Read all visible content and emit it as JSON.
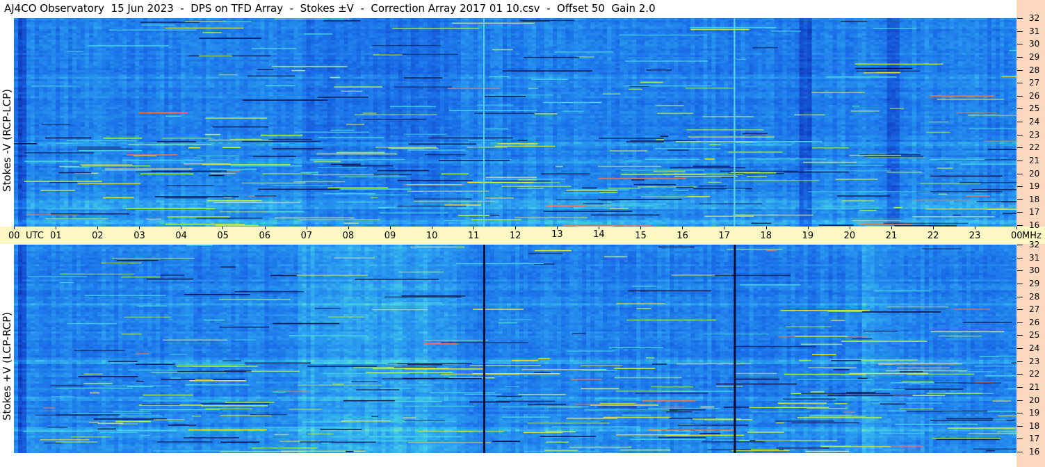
{
  "header": {
    "title": "AJ4CO Observatory  15 Jun 2023  -  DPS on TFD Array  -  Stokes ±V  -  Correction Array 2017 01 10.csv  -  Offset 50  Gain 2.0"
  },
  "colors": {
    "background": "#ffffff",
    "time_band": "#fdf7c3",
    "freq_strip": "#fcd9be",
    "spectrogram_base": "#1a6ee8"
  },
  "chart_data": [
    {
      "type": "heatmap",
      "title": "",
      "ylabel": "Stokes -V (RCP-LCP)",
      "xlabel": "UTC",
      "y_unit": "MHz",
      "x_range": [
        0,
        24
      ],
      "y_range": [
        16,
        32
      ],
      "x_ticks": [
        "00",
        "01",
        "02",
        "03",
        "04",
        "05",
        "06",
        "07",
        "08",
        "09",
        "10",
        "11",
        "12",
        "13",
        "14",
        "15",
        "16",
        "17",
        "18",
        "19",
        "20",
        "21",
        "22",
        "23",
        "00"
      ],
      "y_ticks": [
        "32",
        "31",
        "30",
        "29",
        "28",
        "27",
        "26",
        "25",
        "24",
        "23",
        "22",
        "21",
        "20",
        "19",
        "18",
        "17",
        "16"
      ],
      "vertical_lines_utc": [
        11.25,
        17.25
      ],
      "vertical_line_color": "#58d6f0",
      "dark_columns_utc": [
        0.2,
        18.95,
        21.05
      ],
      "bright_rows_mhz": [
        27.4,
        22.3,
        21.0,
        17.8,
        17.5,
        16.3
      ],
      "colormap": [
        "#0a1e78",
        "#1246c8",
        "#1a6ee8",
        "#2a9cf0",
        "#46d2e6",
        "#b4f050",
        "#f0e628"
      ]
    },
    {
      "type": "heatmap",
      "title": "",
      "ylabel": "Stokes +V (LCP-RCP)",
      "xlabel": "UTC",
      "y_unit": "MHz",
      "x_range": [
        0,
        24
      ],
      "y_range": [
        16,
        32
      ],
      "x_ticks": [
        "00",
        "01",
        "02",
        "03",
        "04",
        "05",
        "06",
        "07",
        "08",
        "09",
        "10",
        "11",
        "12",
        "13",
        "14",
        "15",
        "16",
        "17",
        "18",
        "19",
        "20",
        "21",
        "22",
        "23",
        "00"
      ],
      "y_ticks": [
        "32",
        "31",
        "30",
        "29",
        "28",
        "27",
        "26",
        "25",
        "24",
        "23",
        "22",
        "21",
        "20",
        "19",
        "18",
        "17",
        "16"
      ],
      "vertical_lines_utc": [
        11.25,
        17.25
      ],
      "vertical_line_color": "#04103a",
      "dark_columns_utc": [
        0.2
      ],
      "bright_rows_mhz": [
        27.4,
        23.0,
        20.2,
        17.8
      ],
      "colormap": [
        "#0a1e78",
        "#1246c8",
        "#1a6ee8",
        "#2a9cf0",
        "#46d2e6",
        "#b4f050",
        "#f0e628"
      ]
    }
  ],
  "axis": {
    "utc_label": "UTC",
    "mhz_label": "MHz"
  }
}
